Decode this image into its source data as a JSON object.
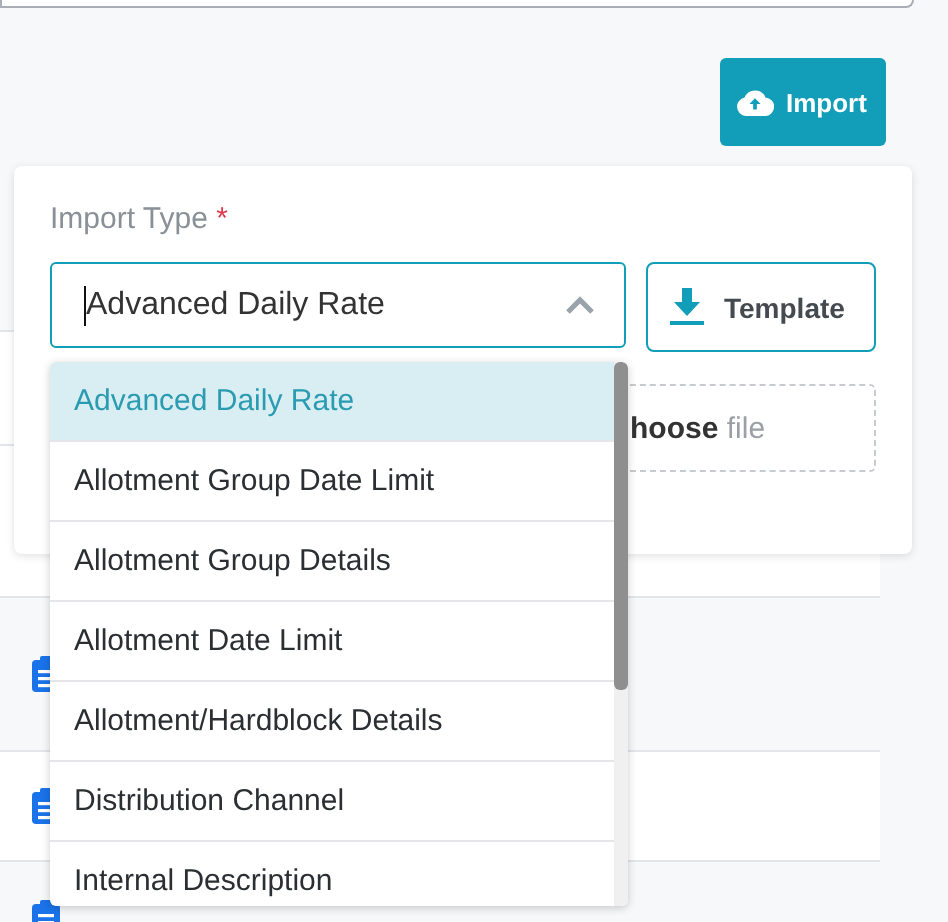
{
  "import_button": {
    "label": "Import"
  },
  "import_panel": {
    "label": "Import Type",
    "required_mark": "*",
    "select": {
      "value": "Advanced Daily Rate",
      "expanded": true
    },
    "template_button": {
      "label": "Template"
    },
    "dropzone": {
      "text": "**hoose** file"
    },
    "options": [
      {
        "label": "Advanced Daily Rate",
        "selected": true
      },
      {
        "label": "Allotment Group Date Limit",
        "selected": false
      },
      {
        "label": "Allotment Group Details",
        "selected": false
      },
      {
        "label": "Allotment Date Limit",
        "selected": false
      },
      {
        "label": "Allotment/Hardblock Details",
        "selected": false
      },
      {
        "label": "Distribution Channel",
        "selected": false
      },
      {
        "label": "Internal Description",
        "selected": false
      }
    ]
  }
}
